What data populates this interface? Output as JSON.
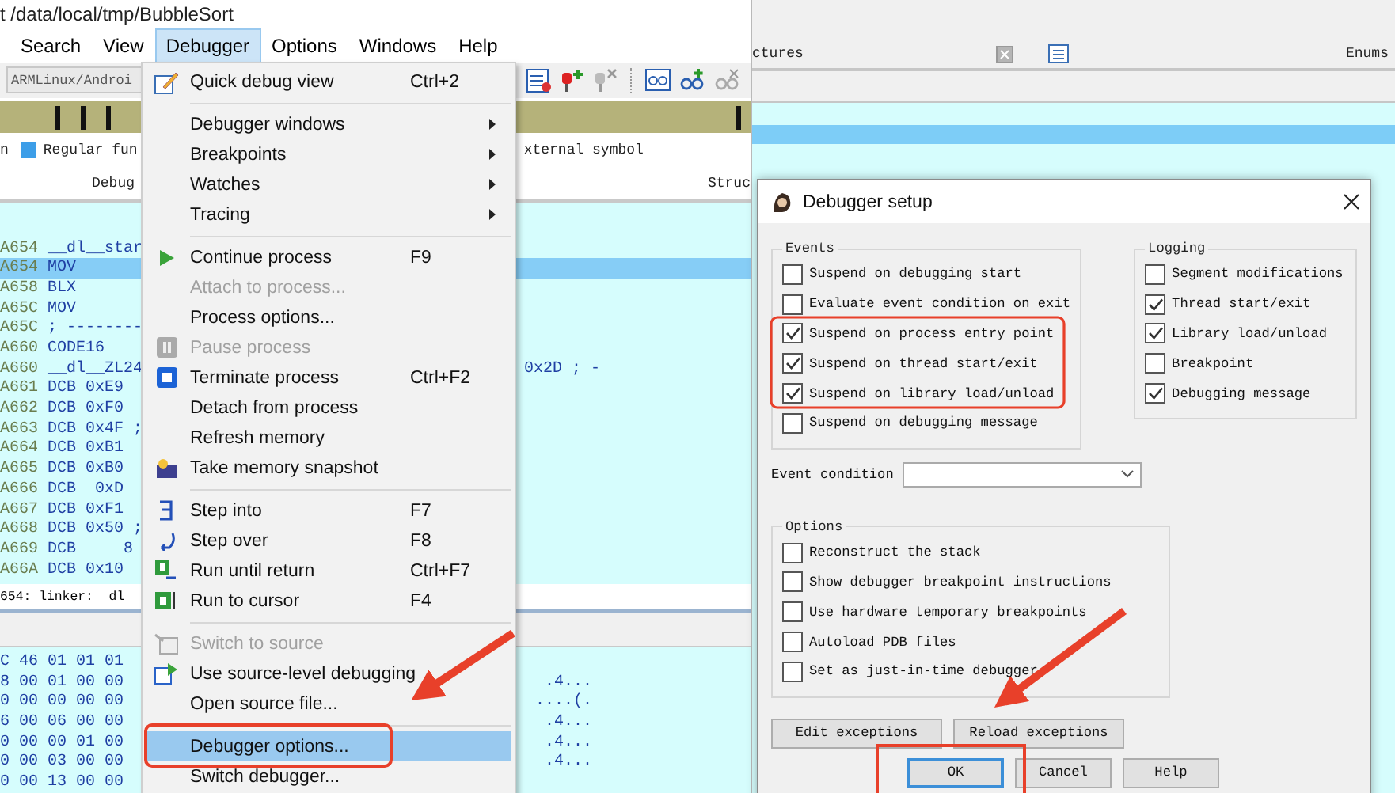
{
  "window": {
    "title": "t /data/local/tmp/BubbleSort"
  },
  "menu_bar": [
    {
      "label": "Search",
      "selected": false
    },
    {
      "label": "View",
      "selected": false
    },
    {
      "label": "Debugger",
      "selected": true
    },
    {
      "label": "Options",
      "selected": false
    },
    {
      "label": "Windows",
      "selected": false
    },
    {
      "label": "Help",
      "selected": false
    }
  ],
  "toolbar": {
    "target": "ARMLinux/Androi"
  },
  "legend": [
    {
      "label": "n"
    },
    {
      "label": "Regular fun",
      "color": "#3d9ee8"
    },
    {
      "label": "xternal symbol"
    }
  ],
  "view_tabs": [
    "Debug",
    "Struc"
  ],
  "side_tabs": [
    "ctures",
    "Enums"
  ],
  "listing": [
    {
      "address": "A654",
      "code": "__dl__star",
      "selected": false
    },
    {
      "address": "A654",
      "code": "MOV",
      "selected": true
    },
    {
      "address": "A658",
      "code": "BLX",
      "selected": false
    },
    {
      "address": "A65C",
      "code": "MOV",
      "selected": false
    },
    {
      "address": "A65C",
      "code": "; --------",
      "selected": false
    },
    {
      "address": "A660",
      "code": "CODE16",
      "selected": false
    },
    {
      "address": "A660",
      "code": "__dl__ZL24",
      "tail": "0x2D ; -",
      "selected": false
    },
    {
      "address": "A661",
      "code": "DCB 0xE9",
      "selected": false
    },
    {
      "address": "A662",
      "code": "DCB 0xF0",
      "selected": false
    },
    {
      "address": "A663",
      "code": "DCB 0x4F ;",
      "selected": false
    },
    {
      "address": "A664",
      "code": "DCB 0xB1",
      "selected": false
    },
    {
      "address": "A665",
      "code": "DCB 0xB0",
      "selected": false
    },
    {
      "address": "A666",
      "code": "DCB  0xD",
      "selected": false
    },
    {
      "address": "A667",
      "code": "DCB 0xF1",
      "selected": false
    },
    {
      "address": "A668",
      "code": "DCB 0x50 ;",
      "selected": false
    },
    {
      "address": "A669",
      "code": "DCB     8",
      "selected": false
    },
    {
      "address": "A66A",
      "code": "DCB 0x10",
      "selected": false
    }
  ],
  "status_line": "654: linker:__dl_",
  "hex_rows": [
    {
      "bytes": "C 46 01 01 01"
    },
    {
      "bytes": "8 00 01 00 00",
      "ascii": ".4..."
    },
    {
      "bytes": "0 00 00 00 00",
      "ascii": "....(."
    },
    {
      "bytes": "6 00 06 00 00",
      "ascii": ".4..."
    },
    {
      "bytes": "0 00 00 01 00",
      "ascii": ".4..."
    },
    {
      "bytes": "0 00 03 00 00",
      "ascii": ".4..."
    },
    {
      "bytes": "0 00 13 00 00"
    }
  ],
  "debugger_menu": [
    {
      "kind": "item",
      "label": "Quick debug view",
      "shortcut": "Ctrl+2",
      "disabled": false,
      "selected": false
    },
    {
      "kind": "separator"
    },
    {
      "kind": "submenu",
      "label": "Debugger windows",
      "disabled": false,
      "selected": false
    },
    {
      "kind": "submenu",
      "label": "Breakpoints",
      "disabled": false,
      "selected": false
    },
    {
      "kind": "submenu",
      "label": "Watches",
      "disabled": false,
      "selected": false
    },
    {
      "kind": "submenu",
      "label": "Tracing",
      "disabled": false,
      "selected": false
    },
    {
      "kind": "separator"
    },
    {
      "kind": "item",
      "label": "Continue process",
      "shortcut": "F9",
      "disabled": false,
      "selected": false
    },
    {
      "kind": "item",
      "label": "Attach to process...",
      "disabled": true,
      "selected": false
    },
    {
      "kind": "item",
      "label": "Process options...",
      "disabled": false,
      "selected": false
    },
    {
      "kind": "item",
      "label": "Pause process",
      "disabled": true,
      "selected": false
    },
    {
      "kind": "item",
      "label": "Terminate process",
      "shortcut": "Ctrl+F2",
      "disabled": false,
      "selected": false
    },
    {
      "kind": "item",
      "label": "Detach from process",
      "disabled": false,
      "selected": false
    },
    {
      "kind": "item",
      "label": "Refresh memory",
      "disabled": false,
      "selected": false
    },
    {
      "kind": "item",
      "label": "Take memory snapshot",
      "disabled": false,
      "selected": false
    },
    {
      "kind": "separator"
    },
    {
      "kind": "item",
      "label": "Step into",
      "shortcut": "F7",
      "disabled": false,
      "selected": false
    },
    {
      "kind": "item",
      "label": "Step over",
      "shortcut": "F8",
      "disabled": false,
      "selected": false
    },
    {
      "kind": "item",
      "label": "Run until return",
      "shortcut": "Ctrl+F7",
      "disabled": false,
      "selected": false
    },
    {
      "kind": "item",
      "label": "Run to cursor",
      "shortcut": "F4",
      "disabled": false,
      "selected": false
    },
    {
      "kind": "separator"
    },
    {
      "kind": "item",
      "label": "Switch to source",
      "disabled": true,
      "selected": false
    },
    {
      "kind": "item",
      "label": "Use source-level debugging",
      "disabled": false,
      "selected": false
    },
    {
      "kind": "item",
      "label": "Open source file...",
      "disabled": false,
      "selected": false
    },
    {
      "kind": "separator"
    },
    {
      "kind": "item",
      "label": "Debugger options...",
      "disabled": false,
      "selected": true
    },
    {
      "kind": "item",
      "label": "Switch debugger...",
      "disabled": false,
      "selected": false
    }
  ],
  "dialog": {
    "title": "Debugger setup",
    "events": {
      "title": "Events",
      "options": [
        {
          "label": "Suspend on debugging start",
          "checked": false
        },
        {
          "label": "Evaluate event condition on exit",
          "checked": false
        },
        {
          "label": "Suspend on process entry point",
          "checked": true
        },
        {
          "label": "Suspend on thread start/exit",
          "checked": true
        },
        {
          "label": "Suspend on library load/unload",
          "checked": true
        },
        {
          "label": "Suspend on debugging message",
          "checked": false
        }
      ]
    },
    "logging": {
      "title": "Logging",
      "options": [
        {
          "label": "Segment modifications",
          "checked": false
        },
        {
          "label": "Thread start/exit",
          "checked": true
        },
        {
          "label": "Library load/unload",
          "checked": true
        },
        {
          "label": "Breakpoint",
          "checked": false
        },
        {
          "label": "Debugging message",
          "checked": true
        }
      ]
    },
    "event_condition": {
      "label": "Event condition"
    },
    "options": {
      "title": "Options",
      "options": [
        {
          "label": "Reconstruct the stack",
          "checked": false
        },
        {
          "label": "Show debugger breakpoint instructions",
          "checked": false
        },
        {
          "label": "Use hardware temporary breakpoints",
          "checked": false
        },
        {
          "label": "Autoload PDB files",
          "checked": false
        },
        {
          "label": "Set as just-in-time debugger",
          "checked": false
        }
      ]
    },
    "exception_buttons": [
      "Edit exceptions",
      "Reload exceptions"
    ],
    "buttons": [
      {
        "label": "OK",
        "default": true
      },
      {
        "label": "Cancel",
        "default": false
      },
      {
        "label": "Help",
        "default": false
      }
    ]
  }
}
